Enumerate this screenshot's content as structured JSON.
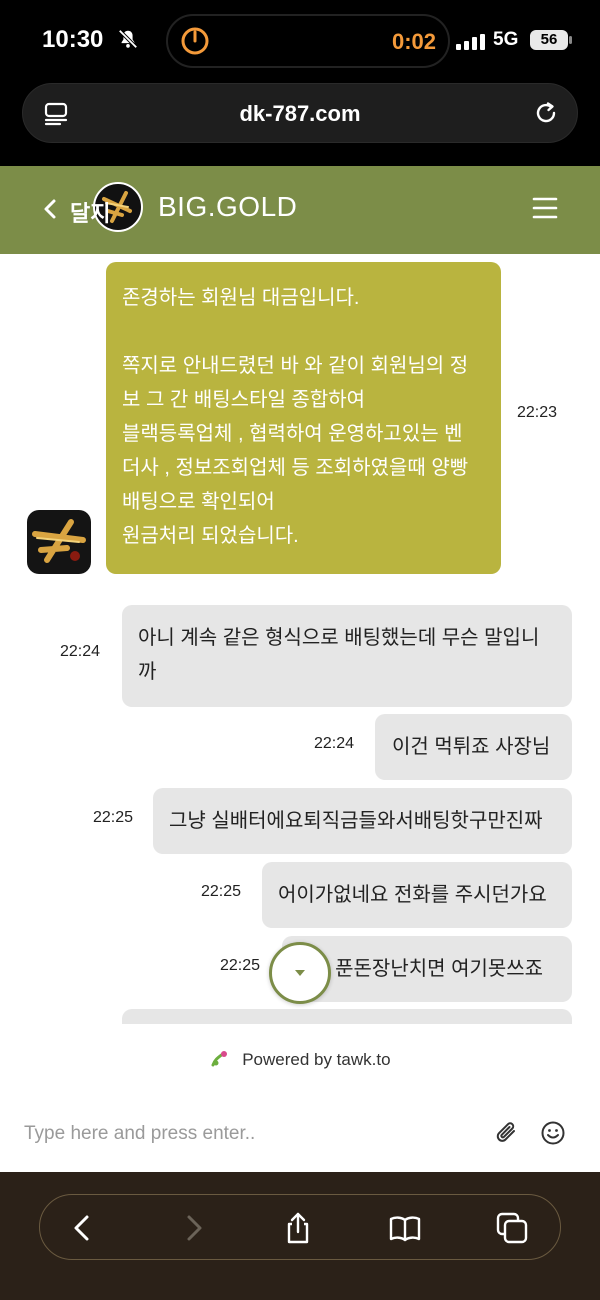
{
  "status_bar": {
    "time": "10:30",
    "timer": "0:02",
    "network": "5G",
    "battery": "56"
  },
  "browser": {
    "url": "dk-787.com"
  },
  "chat_header": {
    "logo_text": "달지",
    "brand": "BIG.GOLD"
  },
  "messages": [
    {
      "from": "agent",
      "time": "22:23",
      "lines": [
        "존경하는 회원님 대금입니다.",
        "",
        "쪽지로 안내드렸던 바 와 같이 회원님의 정",
        "보 그 간 배팅스타일 종합하여",
        "블랙등록업체 , 협력하여 운영하고있는 벤",
        "더사 , 정보조회업체 등 조회하였을때 양빵",
        "배팅으로 확인되어",
        "원금처리 되었습니다."
      ]
    },
    {
      "from": "user",
      "time": "22:24",
      "lines": [
        "아니 계속 같은 형식으로 배팅했는데 무슨 말입니",
        "까"
      ]
    },
    {
      "from": "user",
      "time": "22:24",
      "lines": [
        "이건 먹튀죠 사장님"
      ]
    },
    {
      "from": "user",
      "time": "22:25",
      "lines": [
        "그냥 실배터에요퇴직금들와서배팅핫구만진짜"
      ]
    },
    {
      "from": "user",
      "time": "22:25",
      "lines": [
        "어이가없네요 전화를 주시던가요"
      ]
    },
    {
      "from": "user",
      "time": "22:25",
      "lines": [
        "! 푼돈장난치면 여기못쓰죠"
      ]
    }
  ],
  "footer": {
    "powered_by": "Powered by tawk.to",
    "input_placeholder": "Type here and press enter.."
  },
  "icons": {
    "status": [
      "bell-slash-icon",
      "timer-icon",
      "signal-icon",
      "battery-icon"
    ],
    "browser": [
      "reader-icon",
      "reload-icon"
    ],
    "header": [
      "back-icon",
      "logo",
      "menu-icon"
    ],
    "footer": [
      "tawk-icon",
      "paperclip-icon",
      "emoji-icon"
    ],
    "toolbar": [
      "back-arrow-icon",
      "forward-arrow-icon",
      "share-icon",
      "bookmarks-icon",
      "tabs-icon"
    ]
  },
  "colors": {
    "header_bg": "#7c8d48",
    "agent_bubble": "#b9b43f",
    "user_bubble": "#e6e6e6",
    "timer": "#f49a3a",
    "toolbar_bg": "#2b2118"
  }
}
